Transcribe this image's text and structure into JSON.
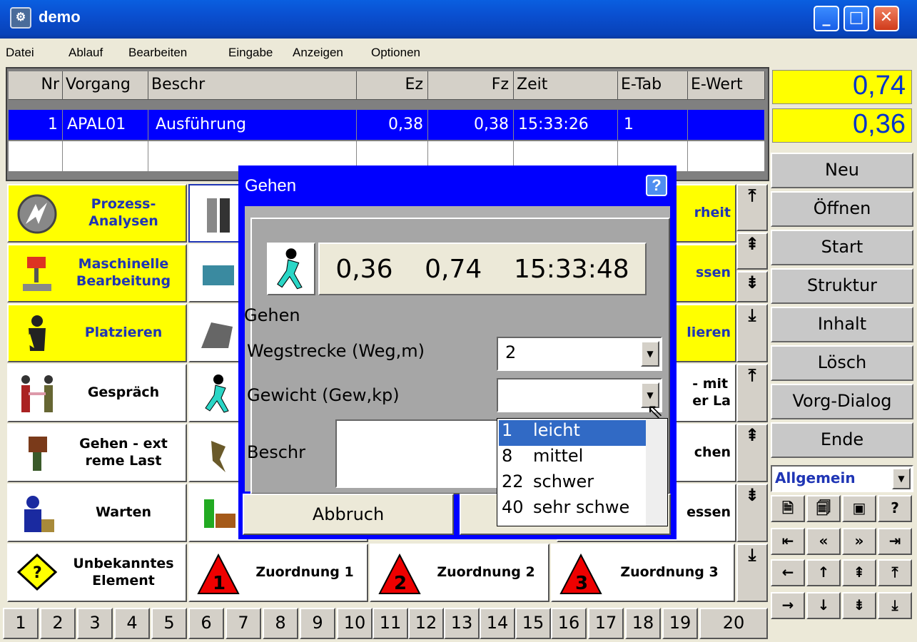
{
  "window": {
    "title": "demo",
    "buttons": [
      "_",
      "□",
      "✕"
    ]
  },
  "menu": [
    "Datei",
    "Ablauf",
    "Bearbeiten",
    "Eingabe",
    "Anzeigen",
    "Optionen"
  ],
  "table": {
    "headers": [
      "Nr",
      "Vorgang",
      "Beschr",
      "Ez",
      "Fz",
      "Zeit",
      "E-Tab",
      "E-Wert"
    ],
    "rows": [
      [
        "1",
        "APAL01",
        "Ausführung",
        "0,38",
        "0,38",
        "15:33:26",
        "1",
        ""
      ]
    ]
  },
  "right_panel": {
    "value_top": "0,74",
    "value_bottom": "0,36",
    "buttons": [
      "Neu",
      "Öffnen",
      "Start",
      "Struktur",
      "Inhalt",
      "Lösch",
      "Vorg-Dialog",
      "Ende"
    ],
    "category": "Allgemein"
  },
  "tiles": {
    "prozess": "Prozess-\nAnalysen",
    "maschinelle": "Maschinelle\nBearbeitung",
    "platzieren": "Platzieren",
    "gespraech": "Gespräch",
    "gehen_ext": "Gehen - ext\nreme Last",
    "warten": "Warten",
    "unbekannt": "Unbekanntes\nElement",
    "zuordnung1": "Zuordnung 1",
    "zuordnung2": "Zuordnung 2",
    "zuordnung3": "Zuordnung 3",
    "right_partial": [
      "rheit",
      "ssen",
      "lieren",
      "- mit\ner La",
      "chen",
      "essen"
    ]
  },
  "numbers": [
    "1",
    "2",
    "3",
    "4",
    "5",
    "6",
    "7",
    "8",
    "9",
    "10",
    "11",
    "12",
    "13",
    "14",
    "15",
    "16",
    "17",
    "18",
    "19",
    "20"
  ],
  "dialog": {
    "title": "Gehen",
    "help": "?",
    "readout": {
      "a": "0,36",
      "b": "0,74",
      "time": "15:33:48"
    },
    "caption": "Gehen",
    "field1_label": "Wegstrecke (Weg,m)",
    "field1_value": "2",
    "field2_label": "Gewicht (Gew,kp)",
    "field2_value": "",
    "field3_label": "Beschr",
    "cancel": "Abbruch",
    "dropdown_options": [
      {
        "num": "1",
        "label": "leicht"
      },
      {
        "num": "8",
        "label": "mittel"
      },
      {
        "num": "22",
        "label": "schwer"
      },
      {
        "num": "40",
        "label": "sehr schwe"
      }
    ]
  },
  "icons": [
    "walking-person-icon",
    "handshake-icon",
    "warning-icon",
    "arrow-icons"
  ]
}
